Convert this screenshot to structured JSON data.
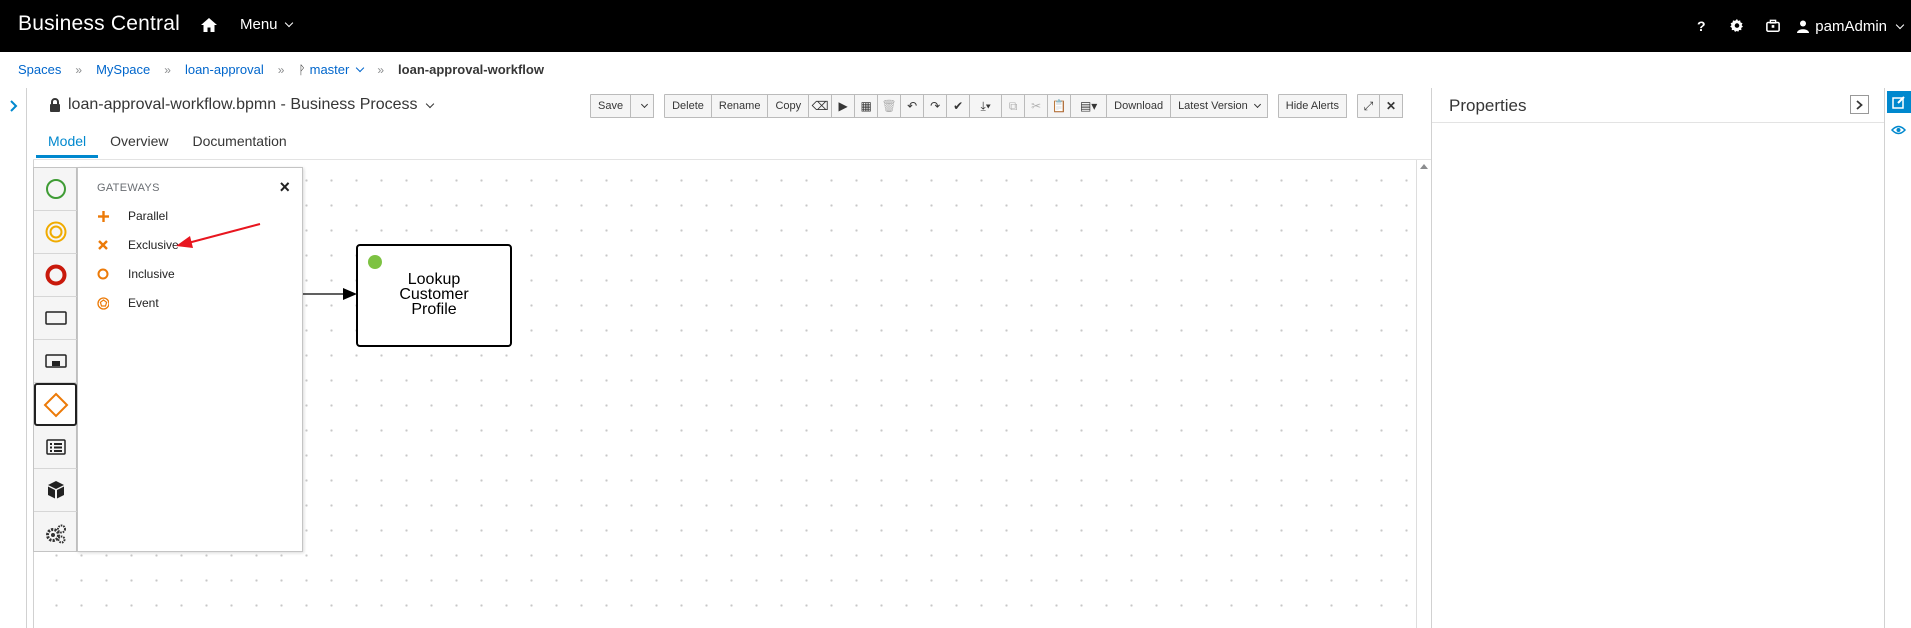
{
  "app": {
    "brand": "Business Central",
    "menu_label": "Menu",
    "user": "pamAdmin",
    "help": "?"
  },
  "breadcrumb": [
    {
      "label": "Spaces"
    },
    {
      "label": "MySpace"
    },
    {
      "label": "loan-approval"
    },
    {
      "label": "master"
    },
    {
      "label": "loan-approval-workflow"
    }
  ],
  "editor": {
    "title": "loan-approval-workflow.bpmn - Business Process",
    "toolbar": {
      "save": "Save",
      "delete": "Delete",
      "rename": "Rename",
      "copy": "Copy",
      "download": "Download",
      "latest_version": "Latest Version",
      "hide_alerts": "Hide Alerts"
    },
    "tabs": [
      {
        "label": "Model",
        "active": true
      },
      {
        "label": "Overview",
        "active": false
      },
      {
        "label": "Documentation",
        "active": false
      }
    ]
  },
  "palette": {
    "items": [
      "start-events",
      "intermediate-events",
      "end-events",
      "activities",
      "subprocesses",
      "gateways",
      "containers",
      "custom-tasks",
      "service-tasks"
    ],
    "selected": "gateways"
  },
  "flyout": {
    "header": "GATEWAYS",
    "items": [
      {
        "label": "Parallel",
        "icon": "plus-icon"
      },
      {
        "label": "Exclusive",
        "icon": "x-icon"
      },
      {
        "label": "Inclusive",
        "icon": "circle-icon"
      },
      {
        "label": "Event",
        "icon": "pentagon-circle-icon"
      }
    ]
  },
  "canvas": {
    "task_label_lines": [
      "Lookup",
      "Customer",
      "Profile"
    ]
  },
  "properties": {
    "title": "Properties"
  },
  "colors": {
    "accent": "#0088ce",
    "gateway_orange": "#ec7a08",
    "start_green": "#3f9c35",
    "end_red": "#c9190b",
    "intermediate_orange": "#f0ab00",
    "annotation_red": "#e8161f"
  }
}
